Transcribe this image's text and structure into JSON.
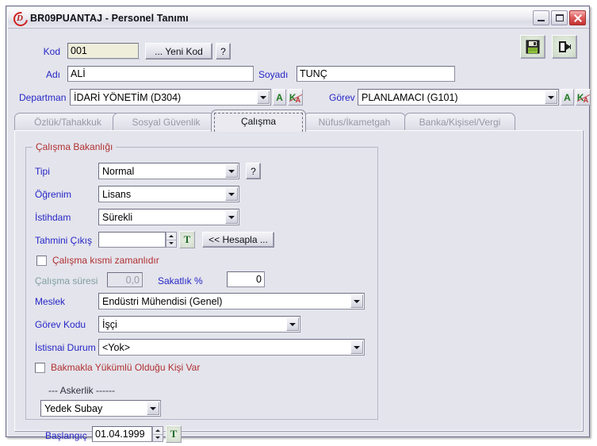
{
  "window": {
    "title": "BR09PUANTAJ - Personel Tanımı",
    "app_icon": "app-logo-icon",
    "buttons": {
      "minimize": "minimize-icon",
      "maximize": "maximize-icon",
      "close": "close-icon"
    }
  },
  "toolbar": {
    "save_icon": "floppy-save-icon",
    "exit_icon": "exit-door-icon"
  },
  "header": {
    "kod_label": "Kod",
    "kod_value": "001",
    "yeni_kod_button": "... Yeni Kod",
    "help_button": "?",
    "adi_label": "Adı",
    "adi_value": "ALİ",
    "soyadi_label": "Soyadı",
    "soyadi_value": "TUNÇ",
    "departman_label": "Departman",
    "departman_value": "İDARİ YÖNETİM (D304)",
    "gorev_label": "Görev",
    "gorev_value": "PLANLAMACI (G101)",
    "a_button": "A",
    "ka_button_k": "K",
    "ka_button_a": "A"
  },
  "tabs": [
    {
      "label": "Özlük/Tahakkuk",
      "active": false
    },
    {
      "label": "Sosyal Güvenlik",
      "active": false
    },
    {
      "label": "Çalışma",
      "active": true
    },
    {
      "label": "Nüfus/İkametgah",
      "active": false
    },
    {
      "label": "Banka/Kişisel/Vergi",
      "active": false
    }
  ],
  "form": {
    "group_title": "Çalışma Bakanlığı",
    "tipi_label": "Tipi",
    "tipi_value": "Normal",
    "tipi_help": "?",
    "ogrenim_label": "Öğrenim",
    "ogrenim_value": "Lisans",
    "istihdam_label": "İstihdam",
    "istihdam_value": "Sürekli",
    "tahmini_cikis_label": "Tahmini Çıkış",
    "tahmini_cikis_value": "",
    "tahmini_cikis_t_button": "T",
    "hesapla_button": "<< Hesapla ...",
    "kismi_zaman_label": "Çalışma kısmi zamanlıdır",
    "kismi_zaman_checked": false,
    "calisma_suresi_label": "Çalışma süresi",
    "calisma_suresi_value": "0,0",
    "sakatlik_label": "Sakatlık %",
    "sakatlik_value": "0",
    "meslek_label": "Meslek",
    "meslek_value": "Endüstri Mühendisi (Genel)",
    "gorev_kodu_label": "Görev Kodu",
    "gorev_kodu_value": "İşçi",
    "istisnai_durum_label": "İstisnai Durum",
    "istisnai_durum_value": "<Yok>",
    "bakmakla_label": "Bakmakla Yükümlü Olduğu Kişi Var",
    "bakmakla_checked": false,
    "askerlik_header": "--- Askerlik ------",
    "askerlik_value": "Yedek Subay",
    "baslangic_label": "Başlangıç",
    "baslangic_value": "01.04.1999",
    "baslangic_t_button": "T"
  },
  "colors": {
    "label_blue": "#2626c8",
    "group_red": "#b03030",
    "disabled_teal": "#7f9f9f",
    "window_bg": "#e4e4ec",
    "khaki_field": "#eeeedb"
  }
}
